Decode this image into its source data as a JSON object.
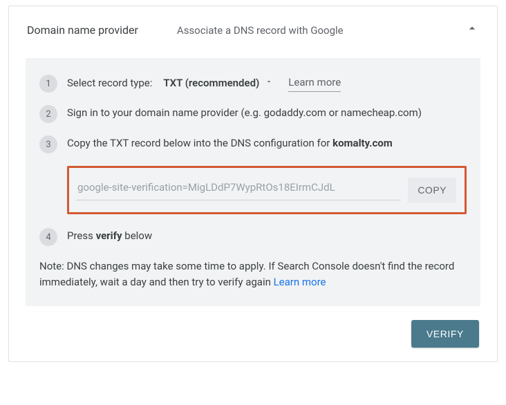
{
  "header": {
    "title": "Domain name provider",
    "subtitle": "Associate a DNS record with Google"
  },
  "steps": {
    "s1": {
      "num": "1",
      "label": "Select record type:",
      "rectype": "TXT (recommended)",
      "learn": "Learn more"
    },
    "s2": {
      "num": "2",
      "text": "Sign in to your domain name provider (e.g. godaddy.com or namecheap.com)"
    },
    "s3": {
      "num": "3",
      "prefix": "Copy the TXT record below into the DNS configuration for ",
      "domain": "komalty.com",
      "txt_value": "google-site-verification=MigLDdP7WypRtOs18EIrmCJdL",
      "copy_label": "COPY"
    },
    "s4": {
      "num": "4",
      "prefix": "Press ",
      "verify_word": "verify",
      "suffix": " below"
    }
  },
  "note": {
    "text": "Note: DNS changes may take some time to apply. If Search Console doesn't find the record immediately, wait a day and then try to verify again ",
    "link": "Learn more"
  },
  "footer": {
    "verify_label": "VERIFY"
  }
}
